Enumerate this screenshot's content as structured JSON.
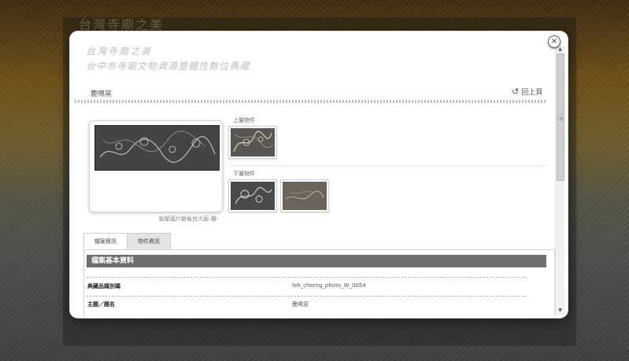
{
  "background": {
    "logo_text": "台灣寺廟之美"
  },
  "modal": {
    "site_title_line1": "台灣寺廟之美",
    "site_title_line2": "台中市寺廟文物資源整體性數位典藏",
    "item_name": "鹿鳴窯",
    "back_label": "回上頁",
    "close_label": "×",
    "zoom_hint": "點擊圖片觀看放大圖",
    "upper_label": "上層物件",
    "lower_label": "下層物件",
    "tabs": [
      {
        "label": "檔案資訊",
        "active": true
      },
      {
        "label": "物件資訊",
        "active": false
      }
    ],
    "info_header": "檔案基本資料",
    "rows": [
      {
        "label": "典藏品識別碼",
        "value": "leh_cherng_photo_W_0054"
      },
      {
        "label": "主題／題名",
        "value": "鹿鳴窯"
      }
    ]
  },
  "colors": {
    "modal_bg": "#ffffff",
    "info_header_bg": "#6e6e6e",
    "tab_inactive_bg": "#e4e4e4"
  },
  "icons": {
    "back": "refresh-arrow-icon",
    "zoom": "magnifier-plus-icon",
    "close": "close-icon"
  }
}
